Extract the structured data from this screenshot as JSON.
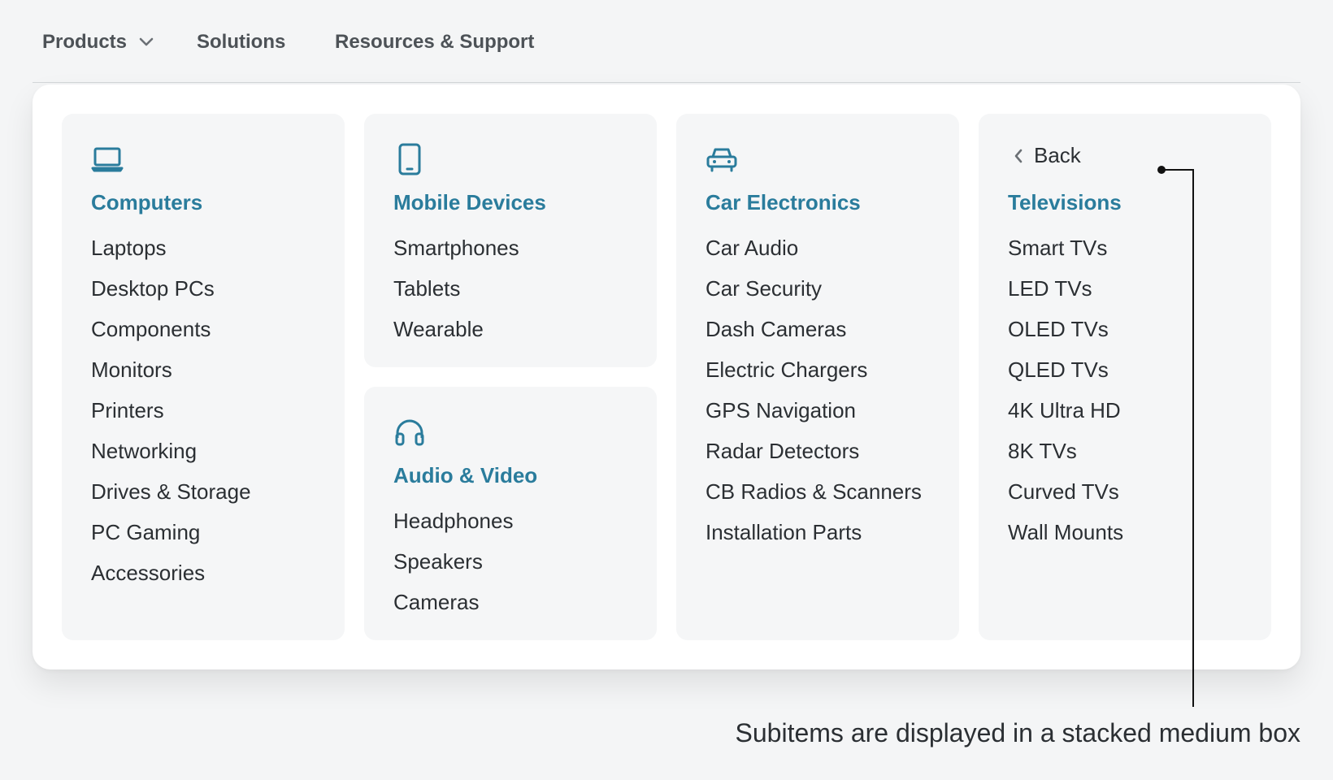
{
  "topnav": {
    "products_label": "Products",
    "solutions_label": "Solutions",
    "resources_label": "Resources & Support"
  },
  "colors": {
    "accent": "#2a7c9c",
    "text": "#2b2f33",
    "panel_bg": "#ffffff",
    "column_bg": "#f5f6f7",
    "page_bg": "#f4f5f6"
  },
  "menu": {
    "computers": {
      "icon": "laptop-icon",
      "title": "Computers",
      "items": [
        "Laptops",
        "Desktop PCs",
        "Components",
        "Monitors",
        "Printers",
        "Networking",
        "Drives & Storage",
        "PC Gaming",
        "Accessories"
      ]
    },
    "mobile": {
      "icon": "tablet-icon",
      "title": "Mobile Devices",
      "items": [
        "Smartphones",
        "Tablets",
        "Wearable"
      ]
    },
    "audio": {
      "icon": "headphones-icon",
      "title": "Audio & Video",
      "items": [
        "Headphones",
        "Speakers",
        "Cameras"
      ]
    },
    "car": {
      "icon": "car-icon",
      "title": "Car Electronics",
      "items": [
        "Car Audio",
        "Car Security",
        "Dash Cameras",
        "Electric Chargers",
        "GPS Navigation",
        "Radar Detectors",
        "CB Radios & Scanners",
        "Installation Parts"
      ]
    },
    "televisions": {
      "back_label": "Back",
      "title": "Televisions",
      "items": [
        "Smart TVs",
        "LED TVs",
        "OLED TVs",
        "QLED TVs",
        "4K Ultra HD",
        "8K TVs",
        "Curved TVs",
        "Wall Mounts"
      ]
    }
  },
  "annotation": {
    "text": "Subitems are displayed in a stacked medium box"
  }
}
